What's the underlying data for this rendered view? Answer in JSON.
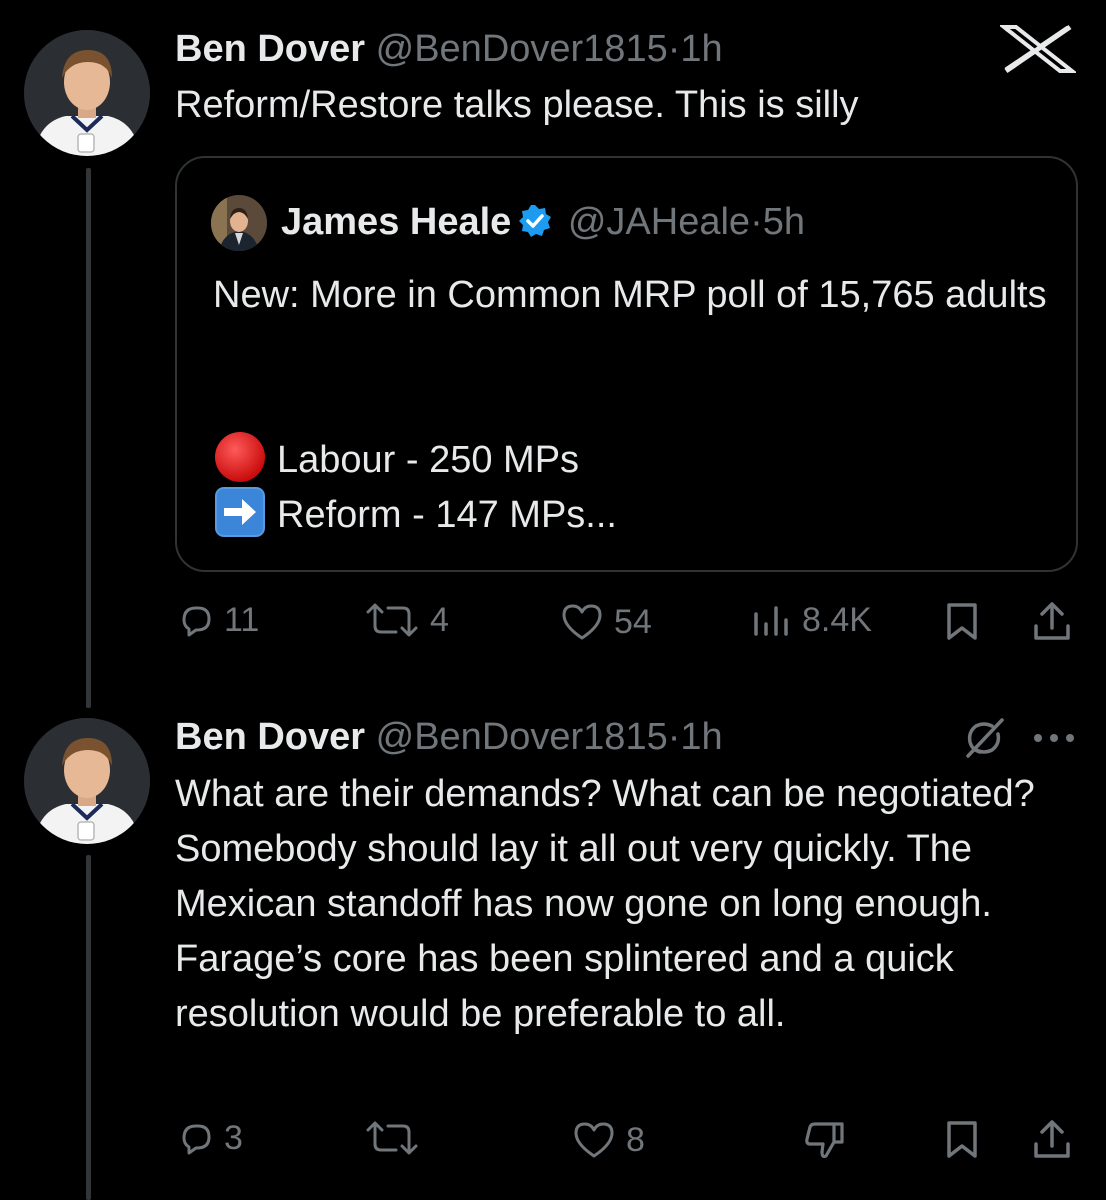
{
  "app": {
    "logo": "x-logo-icon"
  },
  "tweets": [
    {
      "author_name": "Ben Dover",
      "handle": "@BenDover1815",
      "separator": "·",
      "time": "1h",
      "text": "Reform/Restore talks please. This is silly",
      "quote": {
        "author_name": "James Heale",
        "verified": true,
        "handle": "@JAHeale",
        "separator": "·",
        "time": "5h",
        "text": "New: More in Common MRP poll of 15,765 adults",
        "lines": [
          {
            "icon": "red-circle-icon",
            "text": "Labour - 250 MPs"
          },
          {
            "icon": "right-arrow-icon",
            "text": "Reform - 147 MPs..."
          }
        ]
      },
      "actions": {
        "replies": "11",
        "reposts": "4",
        "likes": "54",
        "views": "8.4K"
      }
    },
    {
      "author_name": "Ben Dover",
      "handle": "@BenDover1815",
      "separator": "·",
      "time": "1h",
      "text": "What are their demands? What can be negotiated? Somebody should lay it all out very quickly. The Mexican standoff has now gone on long enough. Farage’s core has been splintered and a quick resolution would be preferable to all.",
      "actions": {
        "replies": "3",
        "likes": "8"
      }
    }
  ],
  "colors": {
    "background": "#000000",
    "text": "#e7e9ea",
    "muted": "#71767b",
    "border": "#2f3336",
    "verified": "#1d9bf0"
  }
}
